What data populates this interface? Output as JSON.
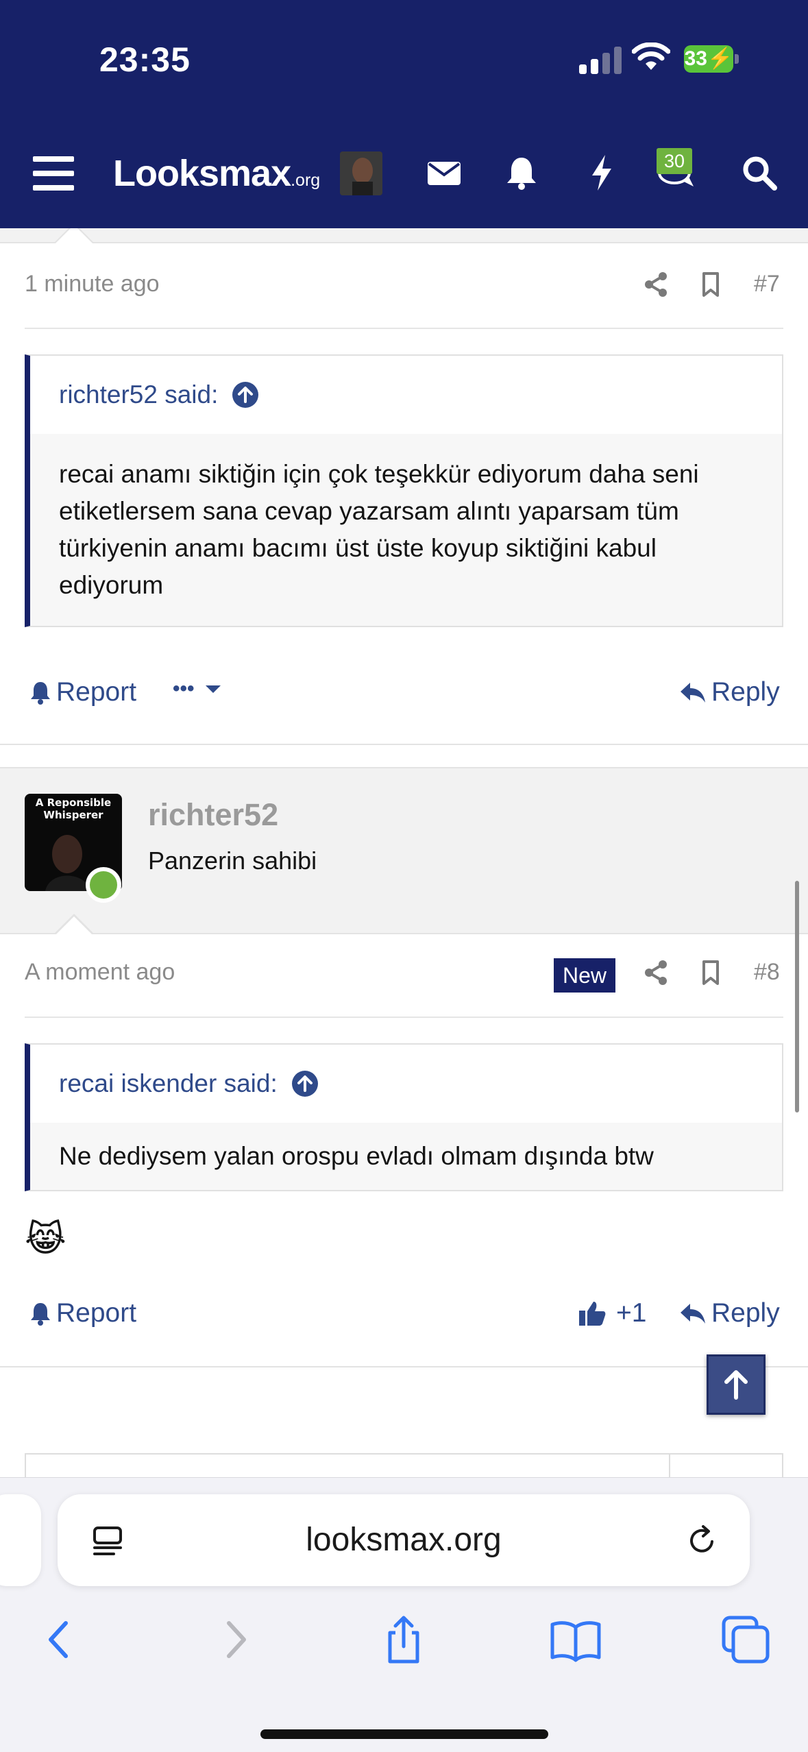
{
  "status_bar": {
    "time": "23:35",
    "battery": "33"
  },
  "site": {
    "logo_main": "Looksmax",
    "logo_suffix": ".org",
    "alerts_badge": "30",
    "icons": [
      "menu-icon",
      "avatar",
      "mail-icon",
      "bell-icon",
      "bolt-icon",
      "chat-icon",
      "search-icon"
    ]
  },
  "post7": {
    "time": "1 minute ago",
    "number": "#7",
    "quote_author": "richter52 said:",
    "quote_text": "recai anamı siktiğin için çok teşekkür ediyorum daha seni etiketlersem sana cevap yazarsam alıntı yaparsam tüm türkiyenin anamı bacımı üst üste koyup siktiğini kabul ediyorum",
    "report_label": "Report",
    "more_label": "•••",
    "reply_label": "Reply"
  },
  "post8": {
    "avatar_caption": "A Reponsible Whisperer",
    "username": "richter52",
    "user_title": "Panzerin sahibi",
    "time": "A moment ago",
    "new_badge": "New",
    "number": "#8",
    "quote_author": "recai iskender said:",
    "quote_text": "Ne dediysem yalan orospu evladı olmam dışında btw",
    "emoji": "😹",
    "report_label": "Report",
    "reaction_count": "+1",
    "reply_label": "Reply"
  },
  "browser": {
    "url": "looksmax.org",
    "colors": {
      "accent": "#3478f6",
      "disabled": "#b8b8bd"
    }
  },
  "colors": {
    "header": "#172168",
    "link": "#2f4a8a",
    "online": "#6fb33f"
  }
}
